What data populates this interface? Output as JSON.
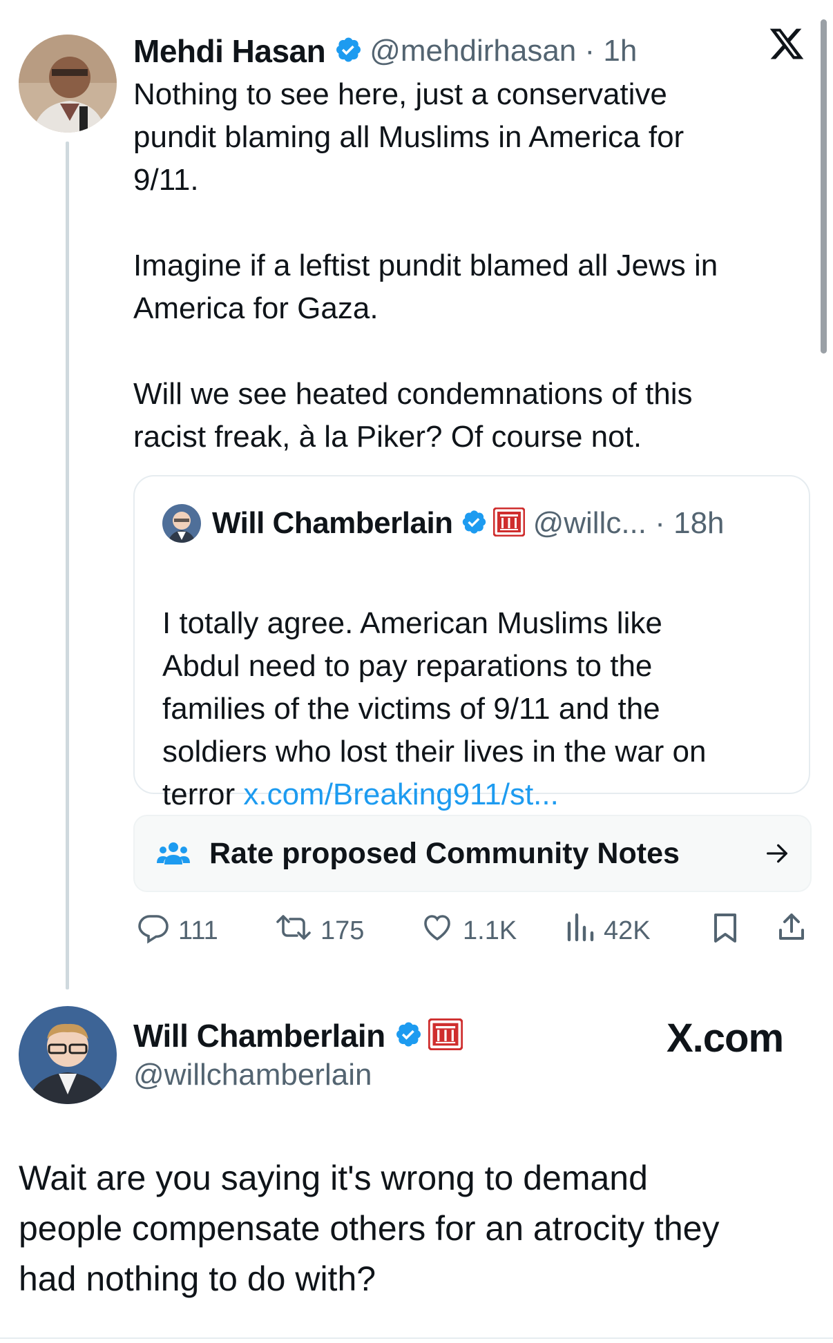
{
  "tweet": {
    "author_name": "Mehdi Hasan",
    "handle_time": "@mehdirhasan · 1h",
    "text": "Nothing to see here, just a conservative\npundit blaming all Muslims in America for\n9/11.\n\nImagine if a leftist pundit blamed all Jews in\nAmerica for Gaza.\n\nWill we see heated condemnations of this\nracist freak, à la Piker? Of course not."
  },
  "quote": {
    "author_name": "Will Chamberlain",
    "handle_time": "@willc... · 18h",
    "text": "I totally agree. American Muslims like\nAbdul need to pay reparations to the\nfamilies of the victims of 9/11 and the\nsoldiers who lost their lives in the war on\nterror ",
    "link": "x.com/Breaking911/st..."
  },
  "community_notes": {
    "label": "Rate proposed Community Notes"
  },
  "actions": {
    "replies": "111",
    "reposts": "175",
    "likes": "1.1K",
    "views": "42K"
  },
  "reply": {
    "author_name": "Will Chamberlain",
    "handle": "@willchamberlain",
    "text": "Wait are you saying it's wrong to demand\npeople compensate others for an atrocity they\nhad nothing to do with?"
  },
  "watermark": "X.com",
  "colors": {
    "verified": "#1d9bf0",
    "link": "#1d9bf0",
    "affiliate_badge": "#cf2e2e",
    "muted": "#536471"
  }
}
